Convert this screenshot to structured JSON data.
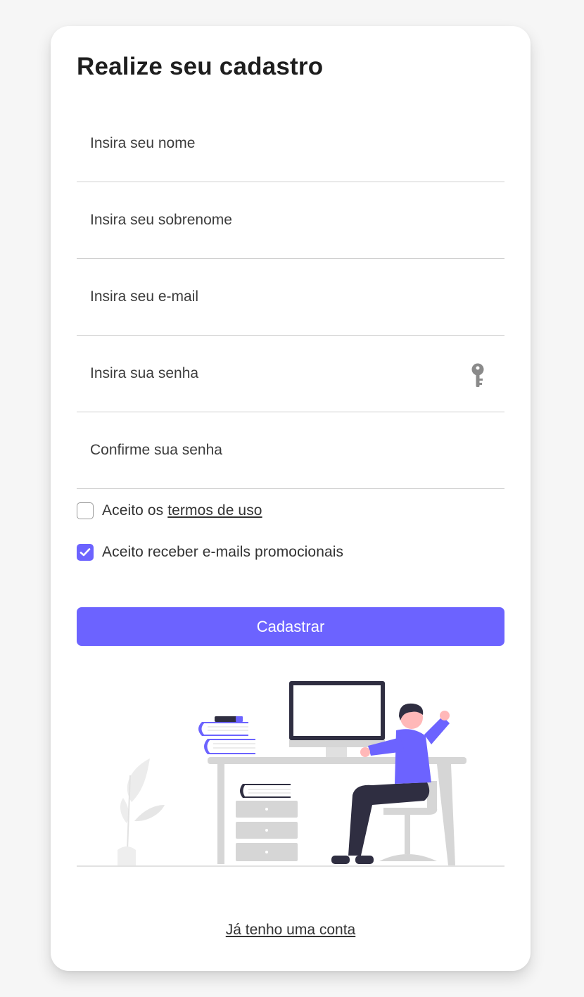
{
  "form": {
    "title": "Realize seu cadastro",
    "fields": [
      {
        "placeholder": "Insira seu nome",
        "value": ""
      },
      {
        "placeholder": "Insira seu sobrenome",
        "value": ""
      },
      {
        "placeholder": "Insira seu e-mail",
        "value": ""
      },
      {
        "placeholder": "Insira sua senha",
        "value": "",
        "icon": "key-icon"
      },
      {
        "placeholder": "Confirme sua senha",
        "value": ""
      }
    ],
    "terms": {
      "prefix": "Aceito os ",
      "link": "termos de uso",
      "checked": false
    },
    "promo": {
      "label": "Aceito receber e-mails promocionais",
      "checked": true
    },
    "submit_label": "Cadastrar",
    "login_link": "Já tenho uma conta"
  },
  "colors": {
    "accent": "#6c63ff",
    "background": "#f6f6f6",
    "card": "#ffffff"
  }
}
